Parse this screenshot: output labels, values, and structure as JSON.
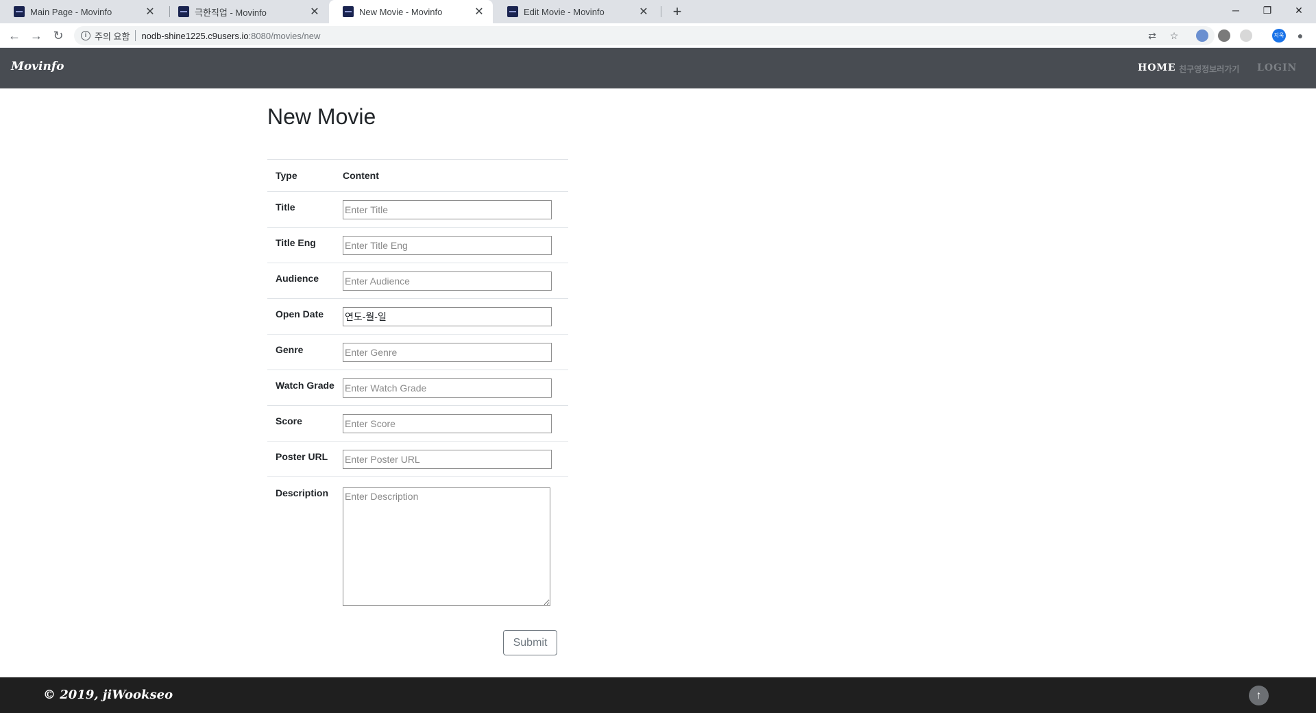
{
  "browser": {
    "tabs": [
      {
        "title": "Main Page - Movinfo",
        "close": "✕"
      },
      {
        "title": "극한직업 - Movinfo",
        "close": "✕"
      },
      {
        "title": "New Movie - Movinfo",
        "close": "✕"
      },
      {
        "title": "Edit Movie - Movinfo",
        "close": "✕"
      }
    ],
    "new_tab": "+",
    "window_controls": {
      "minimize": "─",
      "maximize": "❐",
      "close": "✕"
    },
    "nav": {
      "back": "←",
      "forward": "→",
      "reload": "↻"
    },
    "omnibox": {
      "security_label": "주의 요함",
      "host": "nodb-shine1225.c9users.io",
      "path": ":8080/movies/new"
    },
    "profile_initials": "지욱"
  },
  "site": {
    "brand": "Movinfo",
    "nav": {
      "home": "HOME",
      "friends": "친구영정보러가기",
      "login": "LOGIN"
    }
  },
  "form": {
    "heading": "New Movie",
    "header": {
      "type": "Type",
      "content": "Content"
    },
    "fields": [
      {
        "label": "Title",
        "placeholder": "Enter Title"
      },
      {
        "label": "Title Eng",
        "placeholder": "Enter Title Eng"
      },
      {
        "label": "Audience",
        "placeholder": "Enter Audience"
      },
      {
        "label": "Open Date",
        "value": "연도-월-일"
      },
      {
        "label": "Genre",
        "placeholder": "Enter Genre"
      },
      {
        "label": "Watch Grade",
        "placeholder": "Enter Watch Grade"
      },
      {
        "label": "Score",
        "placeholder": "Enter Score"
      },
      {
        "label": "Poster URL",
        "placeholder": "Enter Poster URL"
      }
    ],
    "description": {
      "label": "Description",
      "placeholder": "Enter Description"
    },
    "submit": "Submit"
  },
  "footer": {
    "copyright": "© 2019, jiWookseo",
    "top_button": "↑"
  },
  "colors": {
    "navbar": "#484c52",
    "footer": "#1f1f1f",
    "submit_border": "#6c757d"
  }
}
